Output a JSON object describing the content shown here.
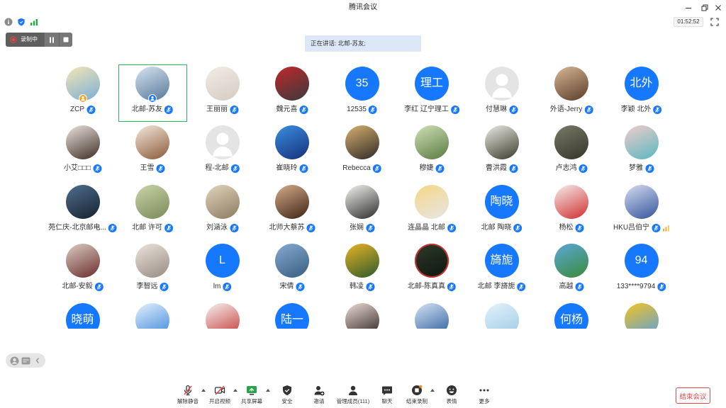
{
  "window": {
    "title": "腾讯会议",
    "controls": [
      "minimize-icon",
      "restore-icon",
      "close-icon"
    ]
  },
  "status": {
    "icons": [
      "info-icon",
      "shield-icon",
      "network-signal-icon"
    ],
    "timer": "01:52:52",
    "fullscreen_icon": "fullscreen-icon"
  },
  "recording": {
    "label": "录制中",
    "icons": [
      "recording-dot-icon",
      "pause-icon",
      "stop-icon"
    ]
  },
  "speaking": {
    "text": "正在讲话: 北邮-苏友;"
  },
  "participants": {
    "text_avatar_color": "#1677ff",
    "default_avatar_color": "#e4e4e4",
    "mic_icon": "mic-muted-icon",
    "mic_color": "#1677ff",
    "selected_border_color": "#2fb45a",
    "rows": [
      [
        {
          "name": "ZCP",
          "avatar": {
            "kind": "photo",
            "colors": [
              "#f4e6b4",
              "#7aaed6"
            ]
          },
          "badge": {
            "icon": "host-badge-icon",
            "color": "#f5a623"
          }
        },
        {
          "name": "北邮-苏友",
          "avatar": {
            "kind": "photo",
            "colors": [
              "#d6e4f0",
              "#56789a"
            ]
          },
          "badge": {
            "icon": "self-badge-icon",
            "color": "#1677ff"
          },
          "selected": true
        },
        {
          "name": "王丽丽",
          "avatar": {
            "kind": "photo",
            "colors": [
              "#f2ece6",
              "#d5cbc2"
            ]
          }
        },
        {
          "name": "魏元喜",
          "avatar": {
            "kind": "photo",
            "colors": [
              "#c0282a",
              "#3a3a3e"
            ]
          }
        },
        {
          "name": "12535",
          "avatar": {
            "kind": "text",
            "text": "35"
          }
        },
        {
          "name": "李红 辽宁理工",
          "avatar": {
            "kind": "text",
            "text": "理工"
          }
        },
        {
          "name": "付慧琳",
          "avatar": {
            "kind": "default"
          }
        },
        {
          "name": "外语-Jerry",
          "avatar": {
            "kind": "photo",
            "colors": [
              "#d8b894",
              "#5a3c2a"
            ]
          }
        },
        {
          "name": "李颖 北外",
          "avatar": {
            "kind": "text",
            "text": "北外"
          }
        }
      ],
      [
        {
          "name": "小艾□□□",
          "avatar": {
            "kind": "photo",
            "colors": [
              "#ece4de",
              "#3e2e26"
            ]
          }
        },
        {
          "name": "王雪",
          "avatar": {
            "kind": "photo",
            "colors": [
              "#f6e8da",
              "#8a5a3a"
            ]
          }
        },
        {
          "name": "程-北邮",
          "avatar": {
            "kind": "default"
          }
        },
        {
          "name": "崔晓玲",
          "avatar": {
            "kind": "photo",
            "colors": [
              "#3a8ee0",
              "#16307a"
            ]
          }
        },
        {
          "name": "Rebecca",
          "avatar": {
            "kind": "photo",
            "colors": [
              "#d8b070",
              "#2e2a26"
            ]
          }
        },
        {
          "name": "穆婕",
          "avatar": {
            "kind": "photo",
            "colors": [
              "#d0e0b8",
              "#5a7a3e"
            ]
          }
        },
        {
          "name": "曹洪霞",
          "avatar": {
            "kind": "photo",
            "colors": [
              "#ecece4",
              "#3a3a2c"
            ]
          }
        },
        {
          "name": "卢志鸿",
          "avatar": {
            "kind": "photo",
            "colors": [
              "#7a7a68",
              "#34342a"
            ]
          }
        },
        {
          "name": "梦雅",
          "avatar": {
            "kind": "photo",
            "colors": [
              "#f2cccc",
              "#58b8c0"
            ]
          }
        }
      ],
      [
        {
          "name": "苑仁庆-北京邮电...",
          "avatar": {
            "kind": "photo",
            "colors": [
              "#4e6e8e",
              "#16222e"
            ]
          }
        },
        {
          "name": "北邮 许可",
          "avatar": {
            "kind": "photo",
            "colors": [
              "#c8d4a8",
              "#7a8a58"
            ]
          }
        },
        {
          "name": "刘涵泳",
          "avatar": {
            "kind": "photo",
            "colors": [
              "#e2d4bc",
              "#8a7a60"
            ]
          }
        },
        {
          "name": "北师大蔡苏",
          "avatar": {
            "kind": "photo",
            "colors": [
              "#d4ac88",
              "#3e2416"
            ]
          }
        },
        {
          "name": "张娴",
          "avatar": {
            "kind": "photo",
            "colors": [
              "#f4f4f0",
              "#2c2c2c"
            ]
          }
        },
        {
          "name": "连晶晶 北邮",
          "avatar": {
            "kind": "photo",
            "colors": [
              "#f6d684",
              "#e6e6e6"
            ]
          }
        },
        {
          "name": "北邮 陶晓",
          "avatar": {
            "kind": "text",
            "text": "陶晓"
          }
        },
        {
          "name": "杨松",
          "avatar": {
            "kind": "photo",
            "colors": [
              "#f6eeee",
              "#d02e2e"
            ]
          }
        },
        {
          "name": "HKU吕伯宁",
          "avatar": {
            "kind": "photo",
            "colors": [
              "#d4dcf2",
              "#34549a"
            ]
          },
          "extra_icon": "network-weak-icon"
        }
      ],
      [
        {
          "name": "北邮-安毅",
          "avatar": {
            "kind": "photo",
            "colors": [
              "#dccdc4",
              "#6a2c2c"
            ]
          }
        },
        {
          "name": "李智远",
          "avatar": {
            "kind": "photo",
            "colors": [
              "#ece4dc",
              "#968a80"
            ]
          }
        },
        {
          "name": "lm",
          "avatar": {
            "kind": "text",
            "text": "L"
          }
        },
        {
          "name": "宋倩",
          "avatar": {
            "kind": "photo",
            "colors": [
              "#86aad0",
              "#365e80"
            ]
          }
        },
        {
          "name": "韩凌",
          "avatar": {
            "kind": "photo",
            "colors": [
              "#eab424",
              "#2c5a2c"
            ]
          }
        },
        {
          "name": "北邮-陈真真",
          "avatar": {
            "kind": "photo",
            "colors": [
              "#2c3a2a",
              "#0e160e"
            ],
            "ring_color": "#c83030"
          }
        },
        {
          "name": "北邮 李旖旎",
          "avatar": {
            "kind": "text",
            "text": "旖旎"
          }
        },
        {
          "name": "高越",
          "avatar": {
            "kind": "photo",
            "colors": [
              "#5aa8d8",
              "#3a8a3a"
            ]
          }
        },
        {
          "name": "133****9794",
          "avatar": {
            "kind": "text",
            "text": "94"
          }
        }
      ],
      [
        {
          "avatar": {
            "kind": "text",
            "text": "晓萌"
          }
        },
        {
          "avatar": {
            "kind": "photo",
            "colors": [
              "#e4f0fc",
              "#3c88dc"
            ]
          }
        },
        {
          "avatar": {
            "kind": "photo",
            "colors": [
              "#f4f2f0",
              "#c43838"
            ]
          }
        },
        {
          "avatar": {
            "kind": "text",
            "text": "陆一"
          }
        },
        {
          "avatar": {
            "kind": "photo",
            "colors": [
              "#ecdcd4",
              "#2a2020"
            ]
          }
        },
        {
          "avatar": {
            "kind": "photo",
            "colors": [
              "#d4e4f4",
              "#2a5a9a"
            ]
          }
        },
        {
          "avatar": {
            "kind": "photo",
            "colors": [
              "#e4f2fa",
              "#9ccae6"
            ]
          }
        },
        {
          "avatar": {
            "kind": "text",
            "text": "何杨"
          }
        },
        {
          "avatar": {
            "kind": "photo",
            "colors": [
              "#f2c420",
              "#5c9ee0"
            ]
          }
        }
      ]
    ]
  },
  "side_controls": {
    "icons": [
      "avatar-view-icon",
      "caption-icon",
      "chevron-left-icon"
    ]
  },
  "toolbar": {
    "items": [
      {
        "label": "解除静音",
        "icon": "mic-muted-icon",
        "menu": true
      },
      {
        "label": "开启视频",
        "icon": "video-off-icon",
        "menu": true
      },
      {
        "label": "共享屏幕",
        "icon": "share-screen-icon",
        "menu": true
      },
      {
        "label": "安全",
        "icon": "shield-icon"
      },
      {
        "label": "邀请",
        "icon": "invite-icon"
      },
      {
        "label": "管理成员(111)",
        "icon": "members-icon"
      },
      {
        "label": "聊天",
        "icon": "chat-icon"
      },
      {
        "label": "结束录制",
        "icon": "end-recording-icon",
        "menu": true
      },
      {
        "label": "表情",
        "icon": "emoji-icon"
      },
      {
        "label": "更多",
        "icon": "more-icon"
      }
    ]
  },
  "end_meeting": {
    "label": "结束会议",
    "color": "#e54545"
  },
  "colors": {
    "accent": "#1677ff",
    "share_green": "#2ba24c",
    "danger": "#e54545",
    "background": "#ffffff"
  }
}
